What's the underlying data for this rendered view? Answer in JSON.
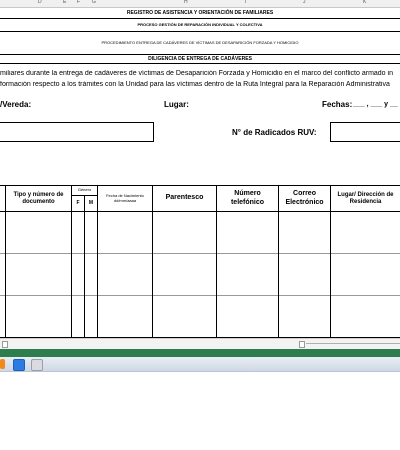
{
  "sheet": {
    "column_letters": [
      {
        "label": "D"
      },
      {
        "label": "E"
      },
      {
        "label": "F"
      },
      {
        "label": "G"
      },
      {
        "label": "H"
      },
      {
        "label": "I"
      },
      {
        "label": "J"
      },
      {
        "label": "K"
      }
    ],
    "title_main": "REGISTRO DE ASISTENCIA Y ORIENTACIÓN DE FAMILIARES",
    "process_line": "PROCESO GESTIÓN DE REPARACIÓN INDIVIDUAL Y COLECTIVA",
    "procedure_line": "PROCEDIMIENTO ENTREGA DE CADÁVERES DE VÍCTIMAS DE DESAPARICIÓN FORZADA Y HOMICIDIO",
    "diligence_title": "DILIGENCIA DE ENTREGA DE CADÁVERES",
    "intro_line1": "miliares durante la entrega de cadáveres de víctimas de Desaparición Forzada y Homicidio en el marco del conflicto armado in",
    "intro_line2": "formación respecto a los trámites con la Unidad para las víctimas dentro de la Ruta Integral para la Reparación Administrativa",
    "vereda_label": "/Vereda:",
    "lugar_label": "Lugar:",
    "fechas_label": "Fechas:",
    "fechas_value": "___ , ___ y __",
    "radicados_label": "N° de Radicados RUV:"
  },
  "table": {
    "headers": {
      "tipo_doc": "Tipo y número de documento",
      "genero": "Género",
      "genero_f": "F",
      "genero_m": "M",
      "fecha_nac": "Fecha de Nacimiento dd/mm/aaaa",
      "parentesco": "Parentesco",
      "telefono": "Número telefónico",
      "correo": "Correo Electrónico",
      "direccion": "Lugar/ Dirección de Residencia"
    }
  },
  "colors": {
    "green_bar": "#2e7d4f",
    "grid_line": "#000000",
    "header_bg": "#f0f0f0"
  }
}
